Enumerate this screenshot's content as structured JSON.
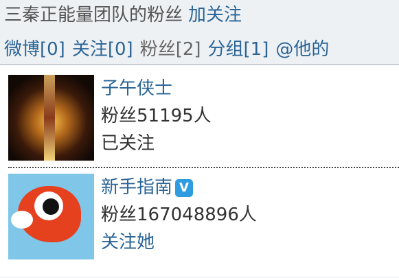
{
  "header": {
    "profile_name": "三秦正能量团队的粉丝",
    "follow_label": "加关注"
  },
  "nav": {
    "weibo": "微博[0]",
    "following": "关注[0]",
    "fans": "粉丝[2]",
    "groups": "分组[1]",
    "mentions": "@他的"
  },
  "fans_list": [
    {
      "name": "子午侠士",
      "fans_count": "粉丝51195人",
      "status": "已关注",
      "avatar_icon": "warrior-avatar",
      "verified": false
    },
    {
      "name": "新手指南",
      "fans_count": "粉丝167048896人",
      "status": "关注她",
      "avatar_icon": "weibo-bird-avatar",
      "verified": true,
      "verified_label": "V"
    }
  ],
  "colors": {
    "link": "#2a6496",
    "header_bg": "#eef1f4",
    "verified_badge": "#2f9be0"
  }
}
